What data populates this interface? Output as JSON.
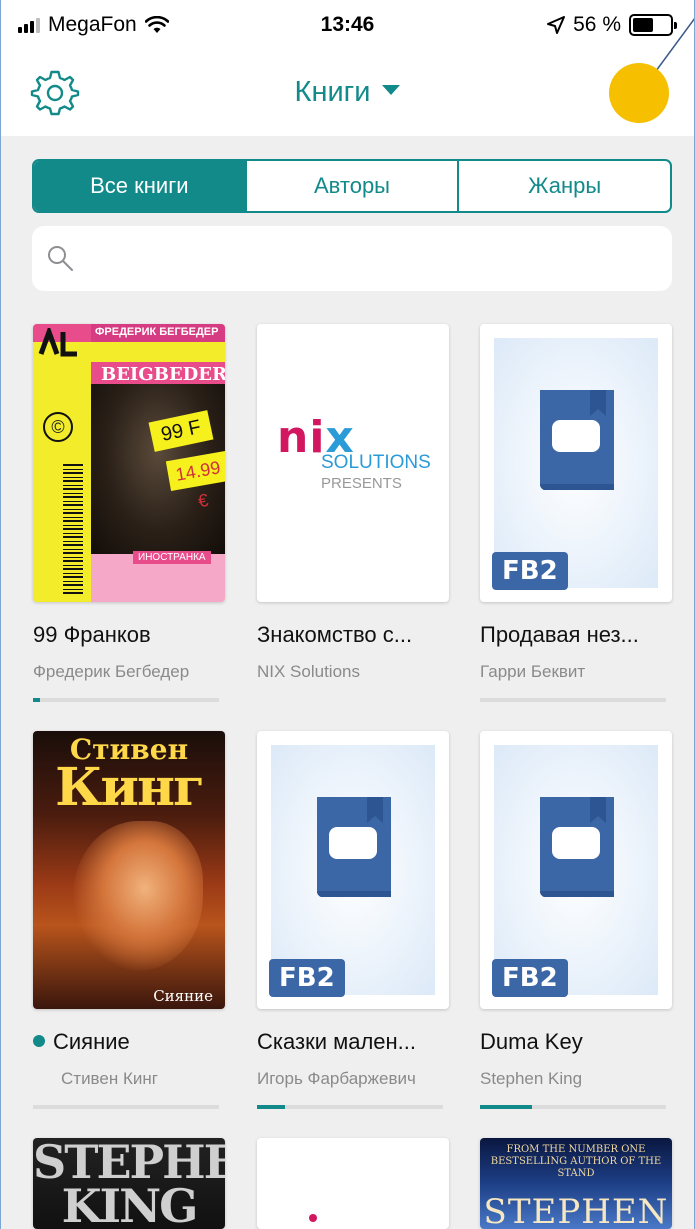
{
  "status_bar": {
    "carrier": "MegaFon",
    "time": "13:46",
    "battery": "56 %",
    "battery_level": 0.56
  },
  "nav": {
    "title": "Книги",
    "settings_icon": "gear-icon",
    "dropdown_icon": "caret-down-icon"
  },
  "tabs": [
    {
      "label": "Все книги",
      "active": true
    },
    {
      "label": "Авторы",
      "active": false
    },
    {
      "label": "Жанры",
      "active": false
    }
  ],
  "search": {
    "placeholder": "",
    "icon": "search-icon"
  },
  "books": [
    {
      "title": "99 Франков",
      "author": "Фредерик Бегбедер",
      "progress": 0.04,
      "cover": "photo",
      "cover_text": {
        "header": "ФРЕДЕРИК БЕГБЕДЕР",
        "brand": "BEIGBEDER",
        "price1": "99 F",
        "price2": "14.99 €",
        "tag": "ИНОСТРАНКА"
      }
    },
    {
      "title": "Знакомство с...",
      "author": "NIX Solutions",
      "progress": 0,
      "cover": "nix",
      "cover_text": {
        "logo_a": "ni",
        "logo_b": "x",
        "line1": "SOLUTIONS",
        "line2": "PRESENTS"
      }
    },
    {
      "title": "Продавая нез...",
      "author": "Гарри Беквит",
      "progress": 0,
      "cover": "fb2",
      "cover_text": {
        "badge": "FB2"
      }
    },
    {
      "title": "Сияние",
      "author": "Стивен Кинг",
      "progress": 0,
      "cover": "photo",
      "unread": true,
      "cover_text": {
        "top": "Стивен",
        "big": "Кинг",
        "sub": "Сияние"
      }
    },
    {
      "title": "Сказки мален...",
      "author": "Игорь Фарбаржевич",
      "progress": 0.15,
      "cover": "fb2",
      "cover_text": {
        "badge": "FB2"
      }
    },
    {
      "title": "Duma Key",
      "author": "Stephen King",
      "progress": 0.28,
      "cover": "fb2",
      "cover_text": {
        "badge": "FB2"
      }
    },
    {
      "title": "",
      "author": "",
      "cover": "photo",
      "cover_text": {
        "big": "STEPHEN KING"
      }
    },
    {
      "title": "",
      "author": "",
      "cover": "blank",
      "cover_text": {}
    },
    {
      "title": "",
      "author": "",
      "cover": "photo",
      "cover_text": {
        "small": "FROM THE NUMBER ONE BESTSELLING AUTHOR OF THE STAND",
        "big": "STEPHEN"
      }
    }
  ],
  "colors": {
    "accent": "#138a8a",
    "marker": "#f6bf00",
    "fb2_blue": "#3b67a7"
  }
}
